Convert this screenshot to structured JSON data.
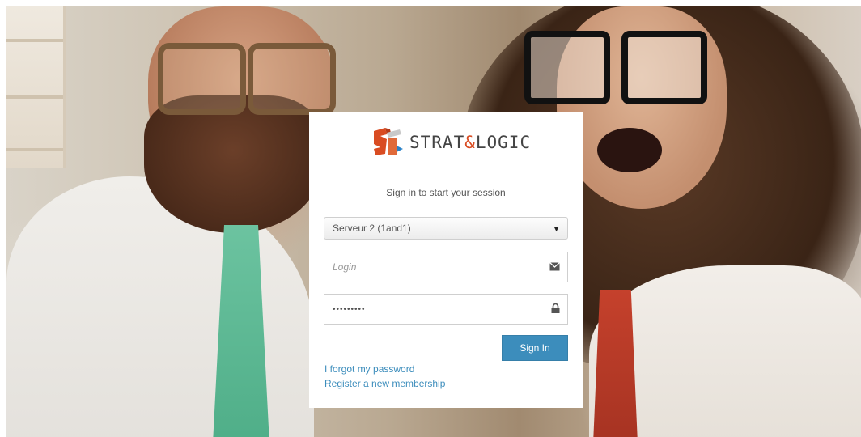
{
  "brand": {
    "name_part1": "STRAT",
    "name_amp": "&",
    "name_part2": "LOGIC",
    "colors": {
      "accent": "#d94c22",
      "mark_blue": "#2a82c8",
      "primary_button": "#3c8dbc"
    }
  },
  "login_box": {
    "subtitle": "Sign in to start your session",
    "server_select": {
      "selected": "Serveur 2 (1and1)"
    },
    "login_field": {
      "value": "",
      "placeholder": "Login",
      "icon": "envelope-icon"
    },
    "password_field": {
      "value": "•••••••••",
      "icon": "lock-icon"
    },
    "sign_in_label": "Sign In",
    "forgot_password": "I forgot my password",
    "register": "Register a new membership"
  }
}
